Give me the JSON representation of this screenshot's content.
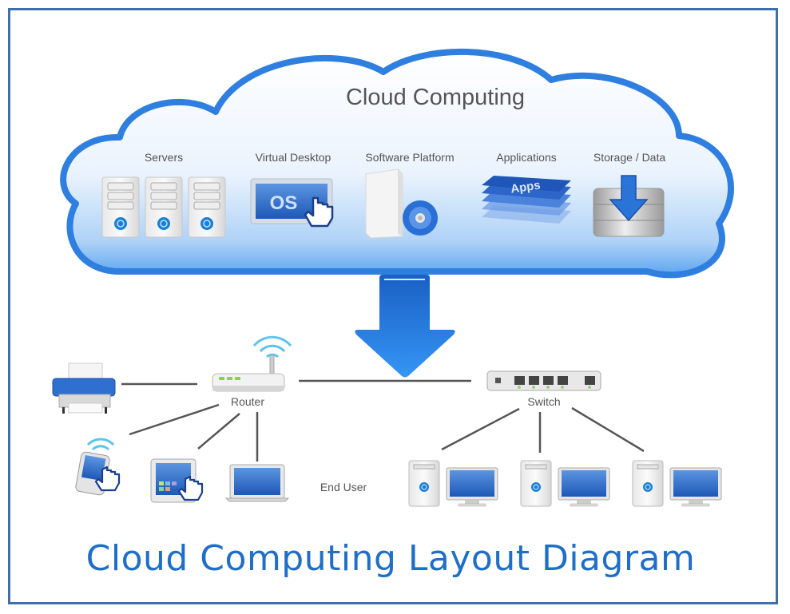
{
  "diagram": {
    "title": "Cloud Computing Layout Diagram",
    "cloud": {
      "title": "Cloud Computing",
      "services": [
        {
          "label": "Servers",
          "icon": "server-rack-icon"
        },
        {
          "label": "Virtual Desktop",
          "icon": "os-monitor-icon",
          "icon_text": "OS"
        },
        {
          "label": "Software Platform",
          "icon": "software-box-disc-icon"
        },
        {
          "label": "Applications",
          "icon": "apps-stack-icon",
          "icon_text": "Apps"
        },
        {
          "label": "Storage / Data",
          "icon": "storage-download-icon"
        }
      ]
    },
    "network": {
      "router": {
        "label": "Router"
      },
      "switch": {
        "label": "Switch"
      },
      "end_user_label": "End User",
      "router_devices": [
        "printer",
        "smartphone",
        "tablet",
        "laptop"
      ],
      "switch_devices": [
        "desktop-pc-1",
        "desktop-pc-2",
        "desktop-pc-3"
      ]
    },
    "colors": {
      "accent": "#1f6fc8",
      "cloud_border": "#2f7fe0",
      "frame_border": "#3d6fa8",
      "arrow": "#2a86ee",
      "text": "#555555",
      "line": "#555555"
    }
  }
}
